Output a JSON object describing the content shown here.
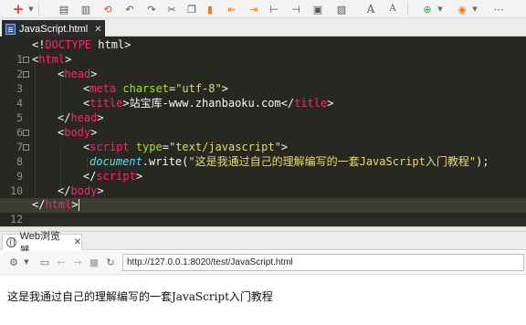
{
  "toolbar": {
    "icons": [
      "new-icon",
      "caret-down-icon",
      "save-icon",
      "save-all-icon",
      "revert-icon",
      "undo-icon",
      "redo-icon",
      "cut-icon",
      "copy-icon",
      "paste-icon",
      "bookmark-icon",
      "bookmark-prev-icon",
      "bookmark-next-icon",
      "indent-icon",
      "outdent-icon",
      "comment-icon",
      "format-icon",
      "font-increase-icon",
      "font-decrease-icon",
      "run-icon",
      "browser-icon",
      "more-icon"
    ],
    "font_up_label": "A",
    "font_down_label": "A"
  },
  "editor": {
    "tab_label": "JavaScript.html",
    "lines": [
      {
        "n": "1",
        "fold": false,
        "current": false
      },
      {
        "n": "2",
        "fold": true,
        "current": false
      },
      {
        "n": "3",
        "fold": true,
        "current": false
      },
      {
        "n": "4",
        "fold": false,
        "current": false
      },
      {
        "n": "5",
        "fold": false,
        "current": false
      },
      {
        "n": "6",
        "fold": false,
        "current": false
      },
      {
        "n": "7",
        "fold": true,
        "current": false
      },
      {
        "n": "8",
        "fold": true,
        "current": false
      },
      {
        "n": "9",
        "fold": false,
        "current": false
      },
      {
        "n": "10",
        "fold": false,
        "current": false
      },
      {
        "n": "11",
        "fold": false,
        "current": false
      },
      {
        "n": "12",
        "fold": false,
        "current": true
      }
    ],
    "code": {
      "l1": {
        "lt": "<!",
        "doctype": "DOCTYPE",
        "rest": " html",
        "gt": ">"
      },
      "l2": {
        "open": "<",
        "tag": "html",
        "close": ">"
      },
      "l3": {
        "open": "<",
        "tag": "head",
        "close": ">"
      },
      "l4": {
        "open": "<",
        "tag": "meta",
        "attr": "charset",
        "eq": "=",
        "val": "\"utf-8\"",
        "close": ">"
      },
      "l5": {
        "open": "<",
        "tag": "title",
        "close": ">",
        "text": "站宝库-www.zhanbaoku.com",
        "end_open": "</",
        "end_tag": "title",
        "end_close": ">"
      },
      "l6": {
        "open": "</",
        "tag": "head",
        "close": ">"
      },
      "l7": {
        "open": "<",
        "tag": "body",
        "close": ">"
      },
      "l8": {
        "open": "<",
        "tag": "script",
        "attr": "type",
        "eq": "=",
        "val": "\"text/javascript\"",
        "close": ">"
      },
      "l9": {
        "obj": "document",
        "method": ".write(",
        "str": "\"这是我通过自己的理解编写的一套JavaScript入门教程\"",
        "end": ");"
      },
      "l10": {
        "open": "</",
        "tag": "script",
        "close": ">"
      },
      "l11": {
        "open": "</",
        "tag": "body",
        "close": ">"
      },
      "l12": {
        "open": "</",
        "tag": "html",
        "close": ">"
      }
    }
  },
  "browser": {
    "tab_label": "Web浏览器",
    "url": "http://127.0.0.1:8020/test/JavaScript.html",
    "content": "这是我通过自己的理解编写的一套JavaScript入门教程"
  },
  "colors": {
    "editor_bg": "#272822",
    "tag": "#f92672",
    "attr": "#a6e22e",
    "string": "#e6db74",
    "object": "#66d9ef",
    "toolbar_red": "#e0403a",
    "toolbar_orange": "#f07a1a"
  }
}
